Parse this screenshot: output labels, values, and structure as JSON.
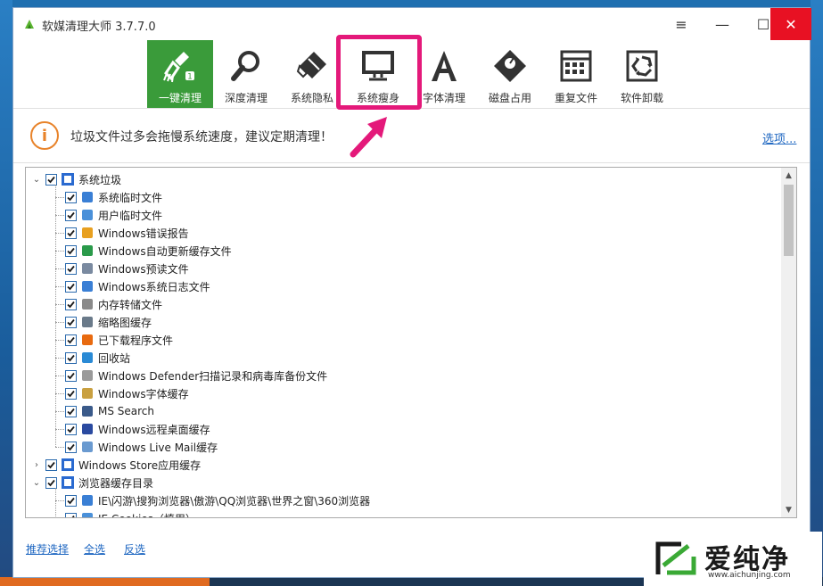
{
  "window": {
    "title": "软媒清理大师 3.7.7.0",
    "controls": {
      "menu": "≡",
      "minimize": "—",
      "maximize": "☐",
      "close": "✕"
    }
  },
  "toolbar": {
    "tools": [
      {
        "label": "一键清理",
        "icon": "broom-icon",
        "active": true
      },
      {
        "label": "深度清理",
        "icon": "magnifier-icon"
      },
      {
        "label": "系统隐私",
        "icon": "eraser-icon"
      },
      {
        "label": "系统瘦身",
        "icon": "monitor-icon"
      },
      {
        "label": "字体清理",
        "icon": "font-a-icon"
      },
      {
        "label": "磁盘占用",
        "icon": "disk-tag-icon"
      },
      {
        "label": "重复文件",
        "icon": "grid-calendar-icon"
      },
      {
        "label": "软件卸载",
        "icon": "recycle-icon"
      }
    ]
  },
  "notice": {
    "icon": "i",
    "text": "垃圾文件过多会拖慢系统速度，建议定期清理！",
    "options_link": "选项..."
  },
  "tree": {
    "groups": [
      {
        "label": "系统垃圾",
        "expanded": true,
        "children": [
          "系统临时文件",
          "用户临时文件",
          "Windows错误报告",
          "Windows自动更新缓存文件",
          "Windows预读文件",
          "Windows系统日志文件",
          "内存转储文件",
          "缩略图缓存",
          "已下载程序文件",
          "回收站",
          "Windows Defender扫描记录和病毒库备份文件",
          "Windows字体缓存",
          "MS Search",
          "Windows远程桌面缓存",
          "Windows Live Mail缓存"
        ]
      },
      {
        "label": "Windows Store应用缓存",
        "expanded": false,
        "children": []
      },
      {
        "label": "浏览器缓存目录",
        "expanded": true,
        "children": [
          "IE\\闪游\\搜狗浏览器\\傲游\\QQ浏览器\\世界之窗\\360浏览器",
          "IE Cookies（慎用）"
        ]
      }
    ]
  },
  "bottom_links": {
    "recommended": "推荐选择",
    "select_all": "全选",
    "invert": "反选"
  },
  "watermark": {
    "text": "爱纯净",
    "url": "www.aichunjing.com"
  },
  "colors": {
    "active_tool": "#3a9b3a",
    "highlight": "#e4197a",
    "link": "#1d66c1",
    "notice_icon": "#e8832a",
    "close_button": "#e81123"
  }
}
